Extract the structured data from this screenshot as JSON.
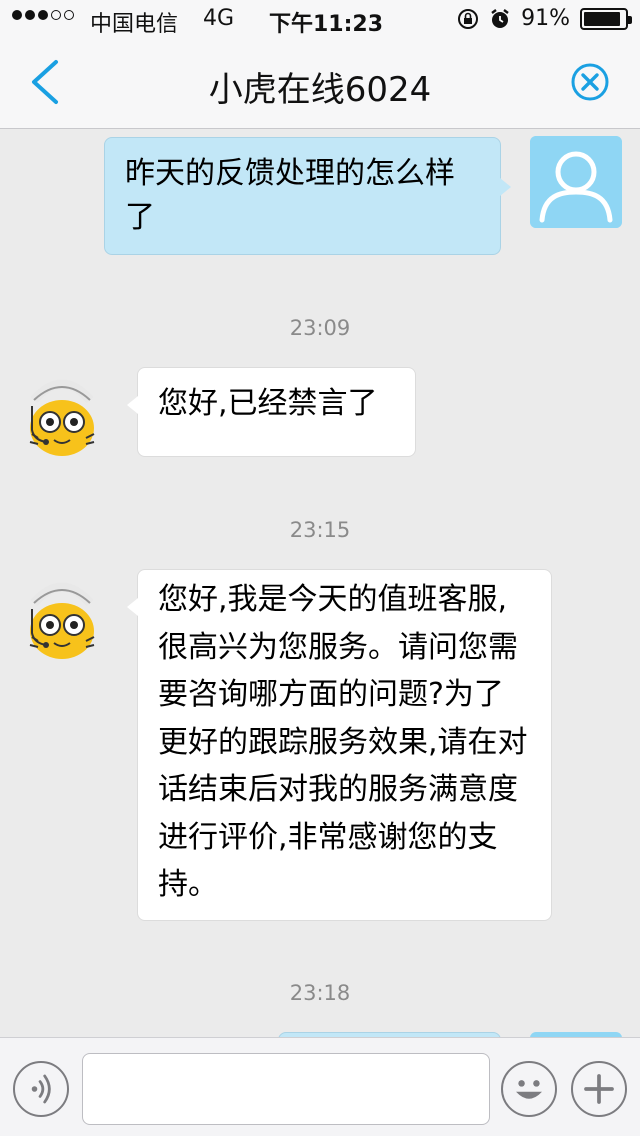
{
  "status_bar": {
    "carrier": "中国电信",
    "network": "4G",
    "time": "下午11:23",
    "battery": "91%",
    "battery_level": 0.91
  },
  "nav": {
    "title": "小虎在线6024"
  },
  "messages": [
    {
      "from": "user",
      "text": "昨天的反馈处理的怎么样了"
    },
    {
      "timestamp": "23:09"
    },
    {
      "from": "agent",
      "text": "您好,已经禁言了"
    },
    {
      "timestamp": "23:15"
    },
    {
      "from": "agent",
      "text": "您好,我是今天的值班客服,很高兴为您服务。请问您需要咨询哪方面的问题?为了更好的跟踪服务效果,请在对话结束后对我的服务满意度进行评价,非常感谢您的支持。"
    },
    {
      "timestamp": "23:18"
    }
  ],
  "input": {
    "placeholder": ""
  },
  "colors": {
    "accent": "#1aa0e2",
    "outgoing_bubble": "#c2e7f7",
    "incoming_bubble": "#ffffff",
    "background": "#ebebeb"
  }
}
